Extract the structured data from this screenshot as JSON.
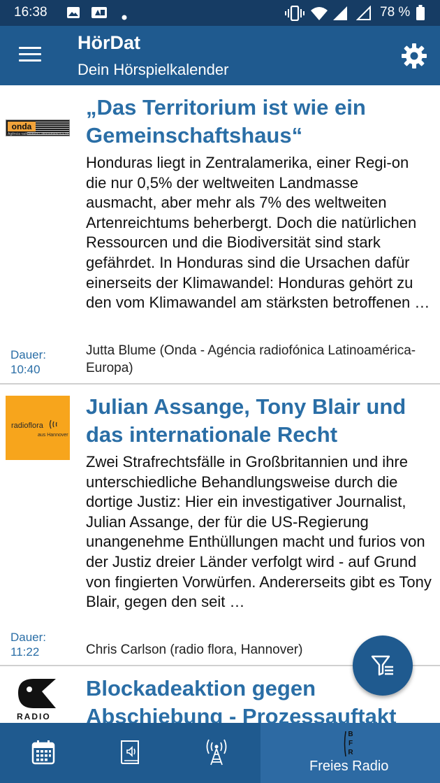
{
  "status_bar": {
    "time": "16:38",
    "battery": "78 %",
    "icons": [
      "image-icon",
      "screenshot-icon",
      "dot-icon",
      "vibrate-icon",
      "wifi-icon",
      "signal-icon",
      "signal-empty-icon",
      "battery-icon"
    ]
  },
  "app_bar": {
    "title": "HörDat",
    "subtitle": "Dein Hörspielkalender",
    "menu_icon": "hamburger-menu-icon",
    "settings_icon": "gear-icon"
  },
  "items": [
    {
      "logo": "onda",
      "logo_caption": "Agência radiofónica Latinoamérica-Europa",
      "title": "„Das Territorium ist wie ein Gemeinschaftshaus“",
      "description": "Honduras liegt in Zentralamerika, einer Regi-on die nur 0,5% der weltweiten Landmasse ausmacht, aber mehr als 7% des weltweiten Artenreichtums beherbergt. Doch die natürlichen Ressourcen und die Biodiversität sind stark gefährdet. In Honduras sind die Ursachen dafür einerseits der Klimawandel: Honduras gehört zu den vom Klimawandel am stärksten betroffenen …",
      "author": "Jutta Blume (Onda - Agéncia radiofónica Latinoamérica-Europa)",
      "duration_label": "Dauer:",
      "duration": "10:40"
    },
    {
      "logo": "radioflora",
      "logo_caption": "aus Hannover",
      "title": "Julian Assange, Tony Blair und das internationale Recht",
      "description": "Zwei Strafrechtsfälle in Großbritannien und ihre unterschiedliche Behandlungsweise durch die dortige Justiz: Hier ein investigativer Journalist, Julian Assange, der für die US-Regierung unangenehme Enthüllungen macht und furios von der Justiz dreier Länder verfolgt wird - auf Grund von fingierten Vorwürfen. Andererseits gibt es Tony Blair, gegen den seit …",
      "author": "Chris Carlson (radio flora, Hannover)",
      "duration_label": "Dauer:",
      "duration": "11:22"
    },
    {
      "logo": "RADIO",
      "title": "Blockadeaktion gegen Abschiebung - Prozessauftakt"
    }
  ],
  "fab": {
    "icon": "filter-list-icon"
  },
  "bottom_nav": {
    "items": [
      {
        "icon": "calendar-icon"
      },
      {
        "icon": "radio-play-book-icon"
      },
      {
        "icon": "radio-tower-icon"
      },
      {
        "icon": "bfr-logo-icon",
        "label": "Freies Radio",
        "active": true
      }
    ]
  },
  "colors": {
    "status_bar": "#163c64",
    "app_bar": "#1f5a8f",
    "accent_title": "#2a6ea6",
    "nav_active": "#2d6aa3"
  }
}
